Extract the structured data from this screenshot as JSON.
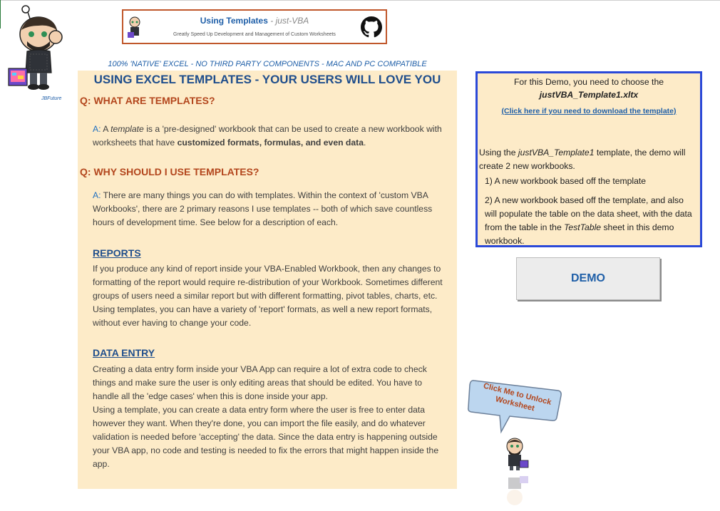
{
  "banner": {
    "title": "Using Templates",
    "title_sep": " - ",
    "title_sub": "just-VBA",
    "subtitle": "Greatly Speed Up Development and Management of  Custom Worksheets"
  },
  "mascot": {
    "caption": "JBFuture"
  },
  "native_line": "100% 'NATIVE' EXCEL - NO THIRD PARTY COMPONENTS - MAC AND PC COMPATIBLE",
  "panel": {
    "title": "USING EXCEL TEMPLATES - YOUR USERS WILL LOVE YOU",
    "q1": "Q: WHAT ARE TEMPLATES?",
    "a1": {
      "label": "A:",
      "pre": " A ",
      "em": "template",
      "mid": "  is a 'pre-designed' workbook that can be used to create a new workbook with worksheets that have ",
      "bold": "customized formats, formulas, and even data",
      "end": "."
    },
    "q2": "Q: WHY SHOULD I USE TEMPLATES?",
    "a2": {
      "label": "A:",
      "text": " There are many things you can do with templates.  Within the context of 'custom VBA Workbooks', there are 2 primary reasons I use templates -- both of which save countless hours of development time.  See below for a description of each."
    },
    "reports_heading": "REPORTS",
    "reports_text": "If you produce any kind of report inside your VBA-Enabled Workbook, then any changes to formatting of the report would require re-distribution of your Workbook. Sometimes different groups of users need a similar report but with different formatting, pivot tables, charts, etc. Using templates, you can have a variety of 'report' formats, as well a new report formats, without ever having to change your code.",
    "data_entry_heading": "DATA ENTRY",
    "data_entry_text1": "Creating a data entry form inside your VBA App can require a lot of extra code to check things and make sure the user is only editing areas that should be edited.  You have to handle all the 'edge cases' when this is done inside your app.",
    "data_entry_text2": "Using a template, you can create a data entry form where the user is free to enter data however they want.  When they're done, you can import the file easily, and do whatever validation is needed before 'accepting' the data.  Since the data entry is happening outside your VBA app, no code and testing is needed to fix the errors that might happen inside the app."
  },
  "infobox": {
    "line1": "For this Demo, you need to choose the",
    "filename": "justVBA_Template1.xltx",
    "download_link": "(Click here if you need to download the template)",
    "using_pre": "Using the ",
    "using_em": "justVBA_Template1",
    "using_post": "  template, the demo will create 2 new workbooks.",
    "item1": "1) A new workbook based off the template",
    "item2_pre": "2) A new workbook based off the template, and also will populate the table on the data sheet, with the data from the table in the ",
    "item2_em": "TestTable",
    "item2_post": "  sheet in this demo workbook."
  },
  "demo_button": "DEMO",
  "unlock_bubble": {
    "line1": "Click Me to Unlock",
    "line2": "Worksheet"
  },
  "colors": {
    "panel_bg": "#fdebc8",
    "heading_blue": "#1f4e8c",
    "question_orange": "#b3461d",
    "infobox_border": "#2b49d8",
    "banner_border": "#c0572b"
  },
  "icons": [
    "github-icon",
    "mascot-image",
    "speech-bubble"
  ]
}
